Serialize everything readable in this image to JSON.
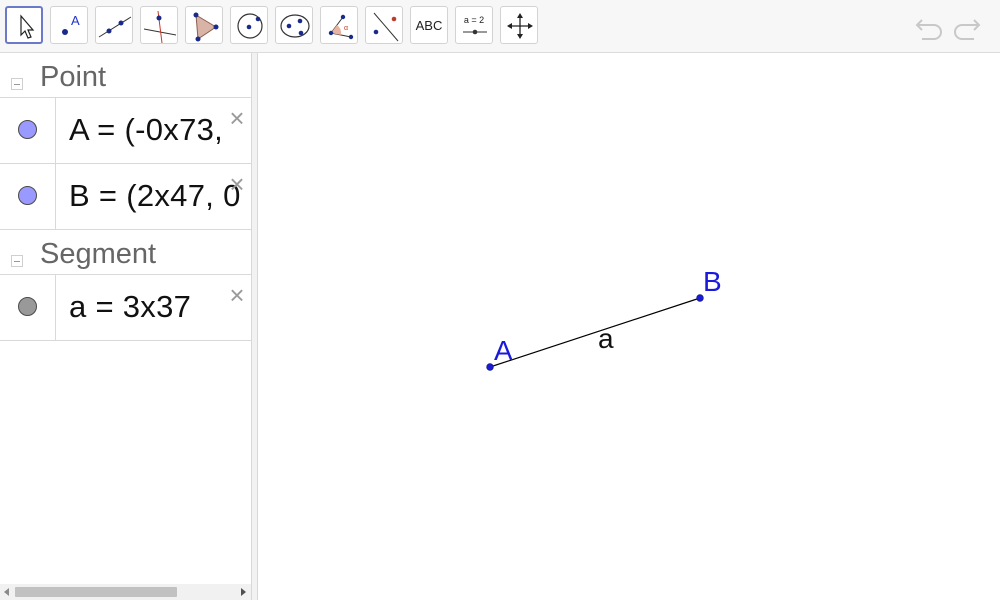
{
  "toolbar": {
    "tools": [
      {
        "name": "move-tool",
        "icon": "arrow-cursor-icon"
      },
      {
        "name": "point-tool",
        "icon": "point-icon",
        "glyph": "A"
      },
      {
        "name": "line-tool",
        "icon": "line-through-points-icon"
      },
      {
        "name": "perpendicular-tool",
        "icon": "perpendicular-line-icon"
      },
      {
        "name": "polygon-tool",
        "icon": "polygon-icon"
      },
      {
        "name": "circle-tool",
        "icon": "circle-center-point-icon"
      },
      {
        "name": "ellipse-tool",
        "icon": "ellipse-icon"
      },
      {
        "name": "angle-tool",
        "icon": "angle-icon",
        "glyph": "α"
      },
      {
        "name": "reflect-tool",
        "icon": "reflect-about-line-icon"
      },
      {
        "name": "text-tool",
        "icon": "text-icon",
        "glyph": "ABC"
      },
      {
        "name": "slider-tool",
        "icon": "slider-icon",
        "glyph": "a = 2"
      },
      {
        "name": "move-graphics-tool",
        "icon": "move-graphics-view-icon"
      }
    ],
    "undo_icon": "undo-icon",
    "redo_icon": "redo-icon"
  },
  "algebra": {
    "groups": [
      {
        "title": "Point",
        "items": [
          {
            "expr": "A  =  (-0x73, ",
            "color": "#9999ff"
          },
          {
            "expr": "B  =  (2x47, 0",
            "color": "#9999ff"
          }
        ]
      },
      {
        "title": "Segment",
        "items": [
          {
            "expr": "a  =  3x37",
            "color": "#999999"
          }
        ]
      }
    ],
    "delete_glyph": "×"
  },
  "graphics": {
    "points": [
      {
        "label": "A",
        "color": "#1a1adb"
      },
      {
        "label": "B",
        "color": "#1a1adb"
      }
    ],
    "segment": {
      "label": "a",
      "color": "#000000"
    }
  }
}
